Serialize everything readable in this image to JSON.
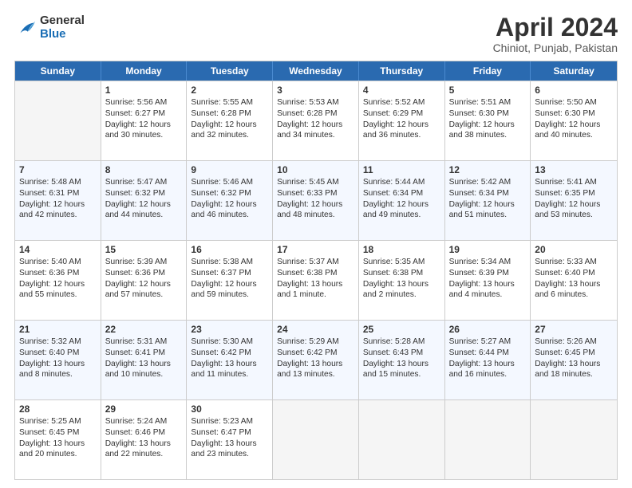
{
  "header": {
    "logo_general": "General",
    "logo_blue": "Blue",
    "main_title": "April 2024",
    "subtitle": "Chiniot, Punjab, Pakistan"
  },
  "days_of_week": [
    "Sunday",
    "Monday",
    "Tuesday",
    "Wednesday",
    "Thursday",
    "Friday",
    "Saturday"
  ],
  "weeks": [
    [
      {
        "num": "",
        "lines": []
      },
      {
        "num": "1",
        "lines": [
          "Sunrise: 5:56 AM",
          "Sunset: 6:27 PM",
          "Daylight: 12 hours",
          "and 30 minutes."
        ]
      },
      {
        "num": "2",
        "lines": [
          "Sunrise: 5:55 AM",
          "Sunset: 6:28 PM",
          "Daylight: 12 hours",
          "and 32 minutes."
        ]
      },
      {
        "num": "3",
        "lines": [
          "Sunrise: 5:53 AM",
          "Sunset: 6:28 PM",
          "Daylight: 12 hours",
          "and 34 minutes."
        ]
      },
      {
        "num": "4",
        "lines": [
          "Sunrise: 5:52 AM",
          "Sunset: 6:29 PM",
          "Daylight: 12 hours",
          "and 36 minutes."
        ]
      },
      {
        "num": "5",
        "lines": [
          "Sunrise: 5:51 AM",
          "Sunset: 6:30 PM",
          "Daylight: 12 hours",
          "and 38 minutes."
        ]
      },
      {
        "num": "6",
        "lines": [
          "Sunrise: 5:50 AM",
          "Sunset: 6:30 PM",
          "Daylight: 12 hours",
          "and 40 minutes."
        ]
      }
    ],
    [
      {
        "num": "7",
        "lines": [
          "Sunrise: 5:48 AM",
          "Sunset: 6:31 PM",
          "Daylight: 12 hours",
          "and 42 minutes."
        ]
      },
      {
        "num": "8",
        "lines": [
          "Sunrise: 5:47 AM",
          "Sunset: 6:32 PM",
          "Daylight: 12 hours",
          "and 44 minutes."
        ]
      },
      {
        "num": "9",
        "lines": [
          "Sunrise: 5:46 AM",
          "Sunset: 6:32 PM",
          "Daylight: 12 hours",
          "and 46 minutes."
        ]
      },
      {
        "num": "10",
        "lines": [
          "Sunrise: 5:45 AM",
          "Sunset: 6:33 PM",
          "Daylight: 12 hours",
          "and 48 minutes."
        ]
      },
      {
        "num": "11",
        "lines": [
          "Sunrise: 5:44 AM",
          "Sunset: 6:34 PM",
          "Daylight: 12 hours",
          "and 49 minutes."
        ]
      },
      {
        "num": "12",
        "lines": [
          "Sunrise: 5:42 AM",
          "Sunset: 6:34 PM",
          "Daylight: 12 hours",
          "and 51 minutes."
        ]
      },
      {
        "num": "13",
        "lines": [
          "Sunrise: 5:41 AM",
          "Sunset: 6:35 PM",
          "Daylight: 12 hours",
          "and 53 minutes."
        ]
      }
    ],
    [
      {
        "num": "14",
        "lines": [
          "Sunrise: 5:40 AM",
          "Sunset: 6:36 PM",
          "Daylight: 12 hours",
          "and 55 minutes."
        ]
      },
      {
        "num": "15",
        "lines": [
          "Sunrise: 5:39 AM",
          "Sunset: 6:36 PM",
          "Daylight: 12 hours",
          "and 57 minutes."
        ]
      },
      {
        "num": "16",
        "lines": [
          "Sunrise: 5:38 AM",
          "Sunset: 6:37 PM",
          "Daylight: 12 hours",
          "and 59 minutes."
        ]
      },
      {
        "num": "17",
        "lines": [
          "Sunrise: 5:37 AM",
          "Sunset: 6:38 PM",
          "Daylight: 13 hours",
          "and 1 minute."
        ]
      },
      {
        "num": "18",
        "lines": [
          "Sunrise: 5:35 AM",
          "Sunset: 6:38 PM",
          "Daylight: 13 hours",
          "and 2 minutes."
        ]
      },
      {
        "num": "19",
        "lines": [
          "Sunrise: 5:34 AM",
          "Sunset: 6:39 PM",
          "Daylight: 13 hours",
          "and 4 minutes."
        ]
      },
      {
        "num": "20",
        "lines": [
          "Sunrise: 5:33 AM",
          "Sunset: 6:40 PM",
          "Daylight: 13 hours",
          "and 6 minutes."
        ]
      }
    ],
    [
      {
        "num": "21",
        "lines": [
          "Sunrise: 5:32 AM",
          "Sunset: 6:40 PM",
          "Daylight: 13 hours",
          "and 8 minutes."
        ]
      },
      {
        "num": "22",
        "lines": [
          "Sunrise: 5:31 AM",
          "Sunset: 6:41 PM",
          "Daylight: 13 hours",
          "and 10 minutes."
        ]
      },
      {
        "num": "23",
        "lines": [
          "Sunrise: 5:30 AM",
          "Sunset: 6:42 PM",
          "Daylight: 13 hours",
          "and 11 minutes."
        ]
      },
      {
        "num": "24",
        "lines": [
          "Sunrise: 5:29 AM",
          "Sunset: 6:42 PM",
          "Daylight: 13 hours",
          "and 13 minutes."
        ]
      },
      {
        "num": "25",
        "lines": [
          "Sunrise: 5:28 AM",
          "Sunset: 6:43 PM",
          "Daylight: 13 hours",
          "and 15 minutes."
        ]
      },
      {
        "num": "26",
        "lines": [
          "Sunrise: 5:27 AM",
          "Sunset: 6:44 PM",
          "Daylight: 13 hours",
          "and 16 minutes."
        ]
      },
      {
        "num": "27",
        "lines": [
          "Sunrise: 5:26 AM",
          "Sunset: 6:45 PM",
          "Daylight: 13 hours",
          "and 18 minutes."
        ]
      }
    ],
    [
      {
        "num": "28",
        "lines": [
          "Sunrise: 5:25 AM",
          "Sunset: 6:45 PM",
          "Daylight: 13 hours",
          "and 20 minutes."
        ]
      },
      {
        "num": "29",
        "lines": [
          "Sunrise: 5:24 AM",
          "Sunset: 6:46 PM",
          "Daylight: 13 hours",
          "and 22 minutes."
        ]
      },
      {
        "num": "30",
        "lines": [
          "Sunrise: 5:23 AM",
          "Sunset: 6:47 PM",
          "Daylight: 13 hours",
          "and 23 minutes."
        ]
      },
      {
        "num": "",
        "lines": []
      },
      {
        "num": "",
        "lines": []
      },
      {
        "num": "",
        "lines": []
      },
      {
        "num": "",
        "lines": []
      }
    ]
  ]
}
